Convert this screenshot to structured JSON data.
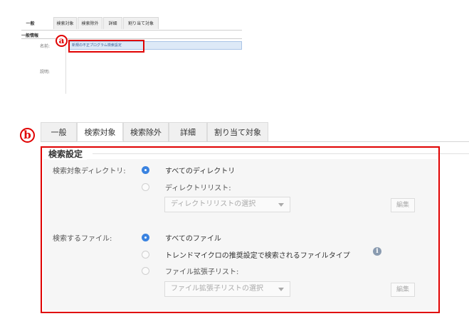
{
  "markers": {
    "a": "a",
    "b": "b"
  },
  "section_a": {
    "tabs": [
      "一般",
      "検索対象",
      "検索除外",
      "詳細",
      "割り当て対象"
    ],
    "group_title": "一般情報",
    "name_label": "名前:",
    "name_value": "新規の不正プログラム検索設定",
    "description_label": "説明:"
  },
  "section_b": {
    "tabs": [
      "一般",
      "検索対象",
      "検索除外",
      "詳細",
      "割り当て対象"
    ],
    "section_title": "検索設定",
    "dir": {
      "label": "検索対象ディレクトリ:",
      "options": [
        "すべてのディレクトリ",
        "ディレクトリリスト:"
      ],
      "select_placeholder": "ディレクトリリストの選択",
      "edit_button": "編集"
    },
    "files": {
      "label": "検索するファイル:",
      "options": [
        "すべてのファイル",
        "トレンドマイクロの推奨設定で検索されるファイルタイプ",
        "ファイル拡張子リスト:"
      ],
      "info_icon": "i",
      "select_placeholder": "ファイル拡張子リストの選択",
      "edit_button": "編集"
    }
  },
  "colors": {
    "highlight": "#e00000",
    "radio_selected": "#3a83e0"
  }
}
